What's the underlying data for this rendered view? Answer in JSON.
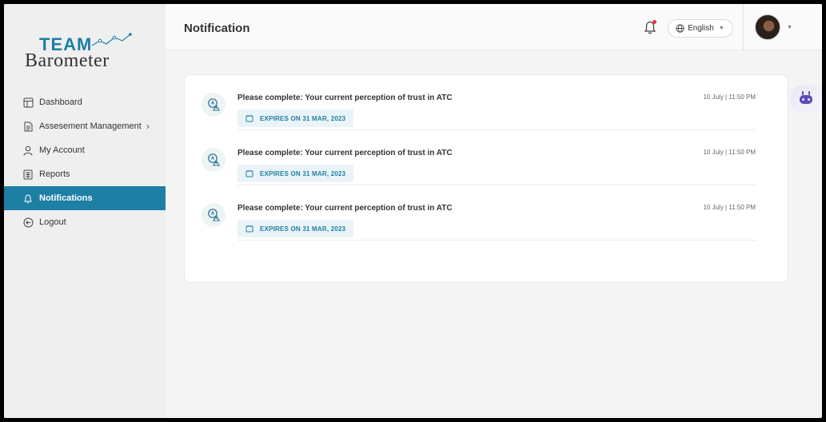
{
  "brand": {
    "line1": "TEAM",
    "line2": "Barometer",
    "accent": "#1d7fa3"
  },
  "sidebar": {
    "items": [
      {
        "label": "Dashboard",
        "icon": "dashboard-icon"
      },
      {
        "label": "Assesement Management",
        "icon": "document-icon",
        "has_submenu": true
      },
      {
        "label": "My Account",
        "icon": "user-icon"
      },
      {
        "label": "Reports",
        "icon": "reports-icon"
      },
      {
        "label": "Notifications",
        "icon": "bell-icon",
        "active": true
      },
      {
        "label": "Logout",
        "icon": "logout-icon"
      }
    ]
  },
  "header": {
    "title": "Notification",
    "language": "English"
  },
  "notifications": [
    {
      "text": "Please complete: Your current perception of trust in ATC",
      "time": "10 July | 11:50 PM",
      "expiry": "EXPIRES ON 31 MAR, 2023"
    },
    {
      "text": "Please complete: Your current perception of trust in ATC",
      "time": "10 July | 11:50 PM",
      "expiry": "EXPIRES ON 31 MAR, 2023"
    },
    {
      "text": "Please complete: Your current perception of trust in ATC",
      "time": "10 July | 11:50 PM",
      "expiry": "EXPIRES ON 31 MAR, 2023"
    }
  ]
}
